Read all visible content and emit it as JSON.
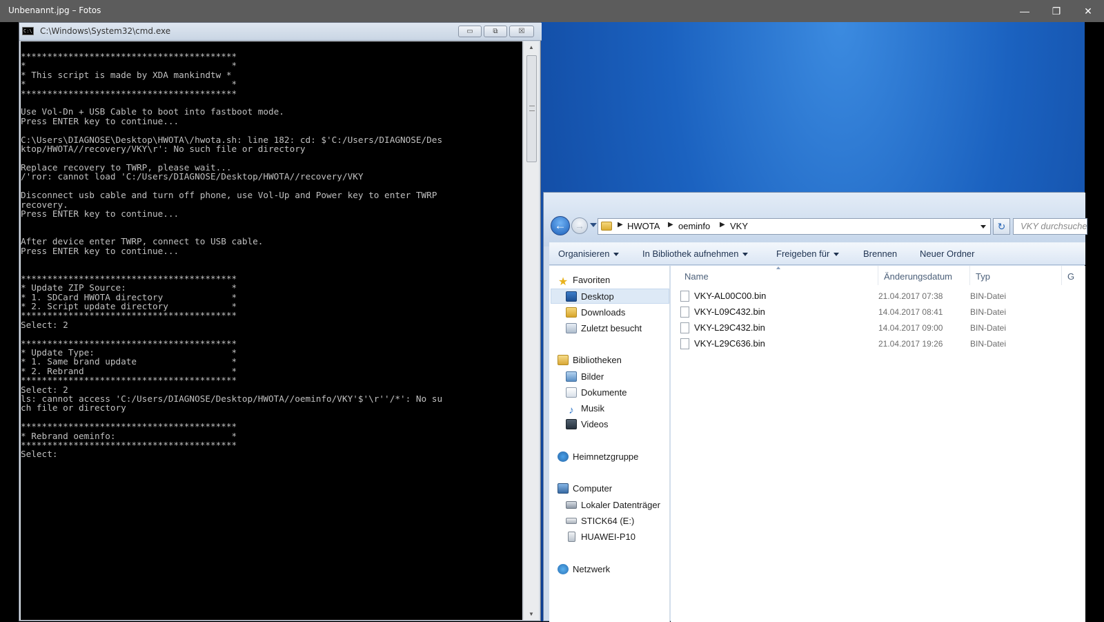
{
  "photos": {
    "title": "Unbenannt.jpg – Fotos",
    "controls": {
      "minimize": "—",
      "maximize": "❐",
      "close": "✕"
    }
  },
  "cmd": {
    "title": "C:\\Windows\\System32\\cmd.exe",
    "icon_text": "C:\\",
    "buttons": {
      "minimize": "▭",
      "maximize": "⧉",
      "close": "☒"
    },
    "scroll_up": "▲",
    "scroll_down": "▼",
    "output": "*****************************************\n*                                       *\n* This script is made by XDA mankindtw *\n*                                       *\n*****************************************\n\nUse Vol-Dn + USB Cable to boot into fastboot mode.\nPress ENTER key to continue...\n\nC:\\Users\\DIAGNOSE\\Desktop\\HWOTA\\/hwota.sh: line 182: cd: $'C:/Users/DIAGNOSE/Des\nktop/HWOTA//recovery/VKY\\r': No such file or directory\n\nReplace recovery to TWRP, please wait...\n/'ror: cannot load 'C:/Users/DIAGNOSE/Desktop/HWOTA//recovery/VKY\n\nDisconnect usb cable and turn off phone, use Vol-Up and Power key to enter TWRP\nrecovery.\nPress ENTER key to continue...\n\n\nAfter device enter TWRP, connect to USB cable.\nPress ENTER key to continue...\n\n\n*****************************************\n* Update ZIP Source:                    *\n* 1. SDCard HWOTA directory             *\n* 2. Script update directory            *\n*****************************************\nSelect: 2\n\n*****************************************\n* Update Type:                          *\n* 1. Same brand update                  *\n* 2. Rebrand                            *\n*****************************************\nSelect: 2\nls: cannot access 'C:/Users/DIAGNOSE/Desktop/HWOTA//oeminfo/VKY'$'\\r''/*': No su\nch file or directory\n\n*****************************************\n* Rebrand oeminfo:                      *\n*****************************************\nSelect:"
  },
  "explorer": {
    "back": "←",
    "forward": "→",
    "refresh": "↻",
    "breadcrumb": [
      "HWOTA",
      "oeminfo",
      "VKY"
    ],
    "breadcrumb_separator": "▶",
    "search_placeholder": "VKY durchsuchen",
    "toolbar": {
      "organize": "Organisieren",
      "include_library": "In Bibliothek aufnehmen",
      "share_with": "Freigeben für",
      "burn": "Brennen",
      "new_folder": "Neuer Ordner"
    },
    "nav": {
      "favorites": "Favoriten",
      "desktop": "Desktop",
      "downloads": "Downloads",
      "recent": "Zuletzt besucht",
      "libraries": "Bibliotheken",
      "pictures": "Bilder",
      "documents": "Dokumente",
      "music": "Musik",
      "videos": "Videos",
      "homegroup": "Heimnetzgruppe",
      "computer": "Computer",
      "local_disk": "Lokaler Datenträger",
      "stick": "STICK64 (E:)",
      "phone": "HUAWEI-P10",
      "network": "Netzwerk"
    },
    "columns": {
      "name": "Name",
      "date": "Änderungsdatum",
      "type": "Typ",
      "size": "G"
    },
    "files": [
      {
        "name": "VKY-AL00C00.bin",
        "date": "21.04.2017 07:38",
        "type": "BIN-Datei"
      },
      {
        "name": "VKY-L09C432.bin",
        "date": "14.04.2017 08:41",
        "type": "BIN-Datei"
      },
      {
        "name": "VKY-L29C432.bin",
        "date": "14.04.2017 09:00",
        "type": "BIN-Datei"
      },
      {
        "name": "VKY-L29C636.bin",
        "date": "21.04.2017 19:26",
        "type": "BIN-Datei"
      }
    ]
  }
}
